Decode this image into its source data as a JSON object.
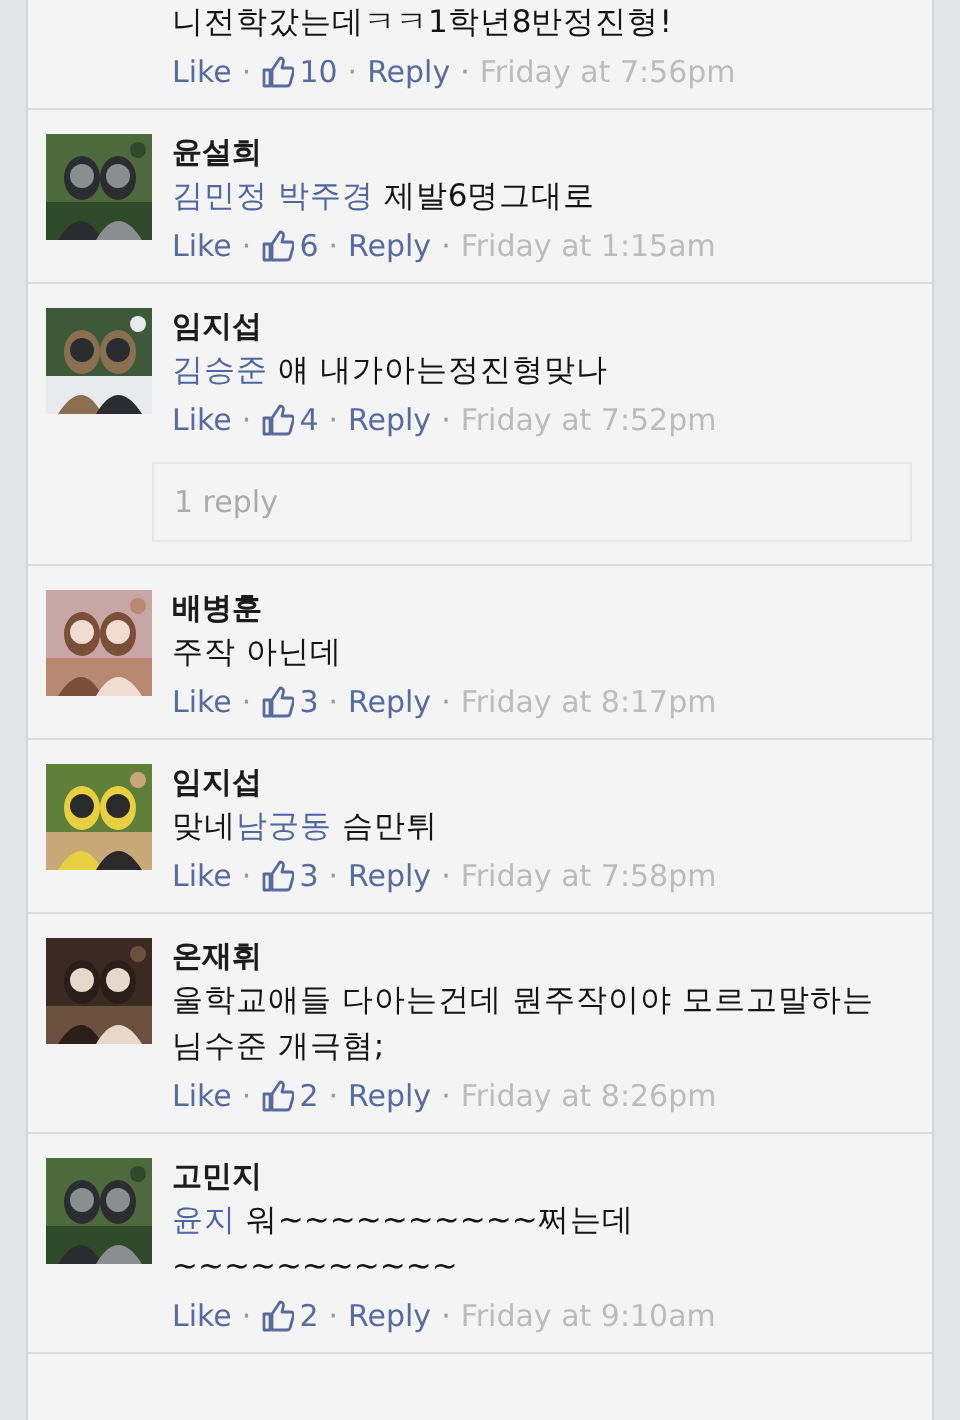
{
  "comments": [
    {
      "body": [
        {
          "kind": "text",
          "text": "니전학갔는데ㅋㅋ1학년8반정진형!"
        }
      ],
      "actions": [
        {
          "kind": "link",
          "text": "Like"
        },
        {
          "kind": "sep",
          "text": "·"
        },
        {
          "kind": "likes",
          "text": "10"
        },
        {
          "kind": "sep",
          "text": "·"
        },
        {
          "kind": "link",
          "text": "Reply"
        },
        {
          "kind": "sep",
          "text": "·"
        },
        {
          "kind": "time",
          "text": "Friday at 7:56pm"
        }
      ]
    },
    {
      "name": "윤설희",
      "avatar": {
        "kind": "picture"
      },
      "body": [
        {
          "kind": "mention",
          "text": "김민정 박주경"
        },
        {
          "kind": "text",
          "text": " 제발6명그대로"
        }
      ],
      "actions": [
        {
          "kind": "link",
          "text": "Like"
        },
        {
          "kind": "sep",
          "text": "·"
        },
        {
          "kind": "likes",
          "text": "6"
        },
        {
          "kind": "sep",
          "text": "·"
        },
        {
          "kind": "link",
          "text": "Reply"
        },
        {
          "kind": "sep",
          "text": "·"
        },
        {
          "kind": "time",
          "text": "Friday at 1:15am"
        }
      ]
    },
    {
      "name": "임지섭",
      "avatar": {
        "kind": "picture"
      },
      "body": [
        {
          "kind": "mention",
          "text": "김승준"
        },
        {
          "kind": "text",
          "text": " 얘 내가아는정진형맞나"
        }
      ],
      "actions": [
        {
          "kind": "link",
          "text": "Like"
        },
        {
          "kind": "sep",
          "text": "·"
        },
        {
          "kind": "likes",
          "text": "4"
        },
        {
          "kind": "sep",
          "text": "·"
        },
        {
          "kind": "link",
          "text": "Reply"
        },
        {
          "kind": "sep",
          "text": "·"
        },
        {
          "kind": "time",
          "text": "Friday at 7:52pm"
        }
      ],
      "replies": "1 reply"
    },
    {
      "name": "배병훈",
      "avatar": {
        "kind": "picture"
      },
      "body": [
        {
          "kind": "text",
          "text": "주작 아닌데"
        }
      ],
      "actions": [
        {
          "kind": "link",
          "text": "Like"
        },
        {
          "kind": "sep",
          "text": "·"
        },
        {
          "kind": "likes",
          "text": "3"
        },
        {
          "kind": "sep",
          "text": "·"
        },
        {
          "kind": "link",
          "text": "Reply"
        },
        {
          "kind": "sep",
          "text": "·"
        },
        {
          "kind": "time",
          "text": "Friday at 8:17pm"
        }
      ]
    },
    {
      "name": "임지섭",
      "avatar": {
        "kind": "picture"
      },
      "body": [
        {
          "kind": "text",
          "text": "맞네"
        },
        {
          "kind": "mention",
          "text": "남궁동"
        },
        {
          "kind": "text",
          "text": " 슴만튀"
        }
      ],
      "actions": [
        {
          "kind": "link",
          "text": "Like"
        },
        {
          "kind": "sep",
          "text": "·"
        },
        {
          "kind": "likes",
          "text": "3"
        },
        {
          "kind": "sep",
          "text": "·"
        },
        {
          "kind": "link",
          "text": "Reply"
        },
        {
          "kind": "sep",
          "text": "·"
        },
        {
          "kind": "time",
          "text": "Friday at 7:58pm"
        }
      ]
    },
    {
      "name": "온재휘",
      "avatar": {
        "kind": "picture"
      },
      "body": [
        {
          "kind": "text",
          "text": "울학교애들 다아는건데 뭔주작이야 모르고말하는 님수준 개극혐;"
        }
      ],
      "actions": [
        {
          "kind": "link",
          "text": "Like"
        },
        {
          "kind": "sep",
          "text": "·"
        },
        {
          "kind": "likes",
          "text": "2"
        },
        {
          "kind": "sep",
          "text": "·"
        },
        {
          "kind": "link",
          "text": "Reply"
        },
        {
          "kind": "sep",
          "text": "·"
        },
        {
          "kind": "time",
          "text": "Friday at 8:26pm"
        }
      ]
    },
    {
      "name": "고민지",
      "avatar": {
        "kind": "picture"
      },
      "body": [
        {
          "kind": "mention",
          "text": "윤지"
        },
        {
          "kind": "text",
          "text": " 워~~~~~~~~~~쩌는데~~~~~~~~~~~"
        }
      ],
      "actions": [
        {
          "kind": "link",
          "text": "Like"
        },
        {
          "kind": "sep",
          "text": "·"
        },
        {
          "kind": "likes",
          "text": "2"
        },
        {
          "kind": "sep",
          "text": "·"
        },
        {
          "kind": "link",
          "text": "Reply"
        },
        {
          "kind": "sep",
          "text": "·"
        },
        {
          "kind": "time",
          "text": "Friday at 9:10am"
        }
      ]
    }
  ]
}
